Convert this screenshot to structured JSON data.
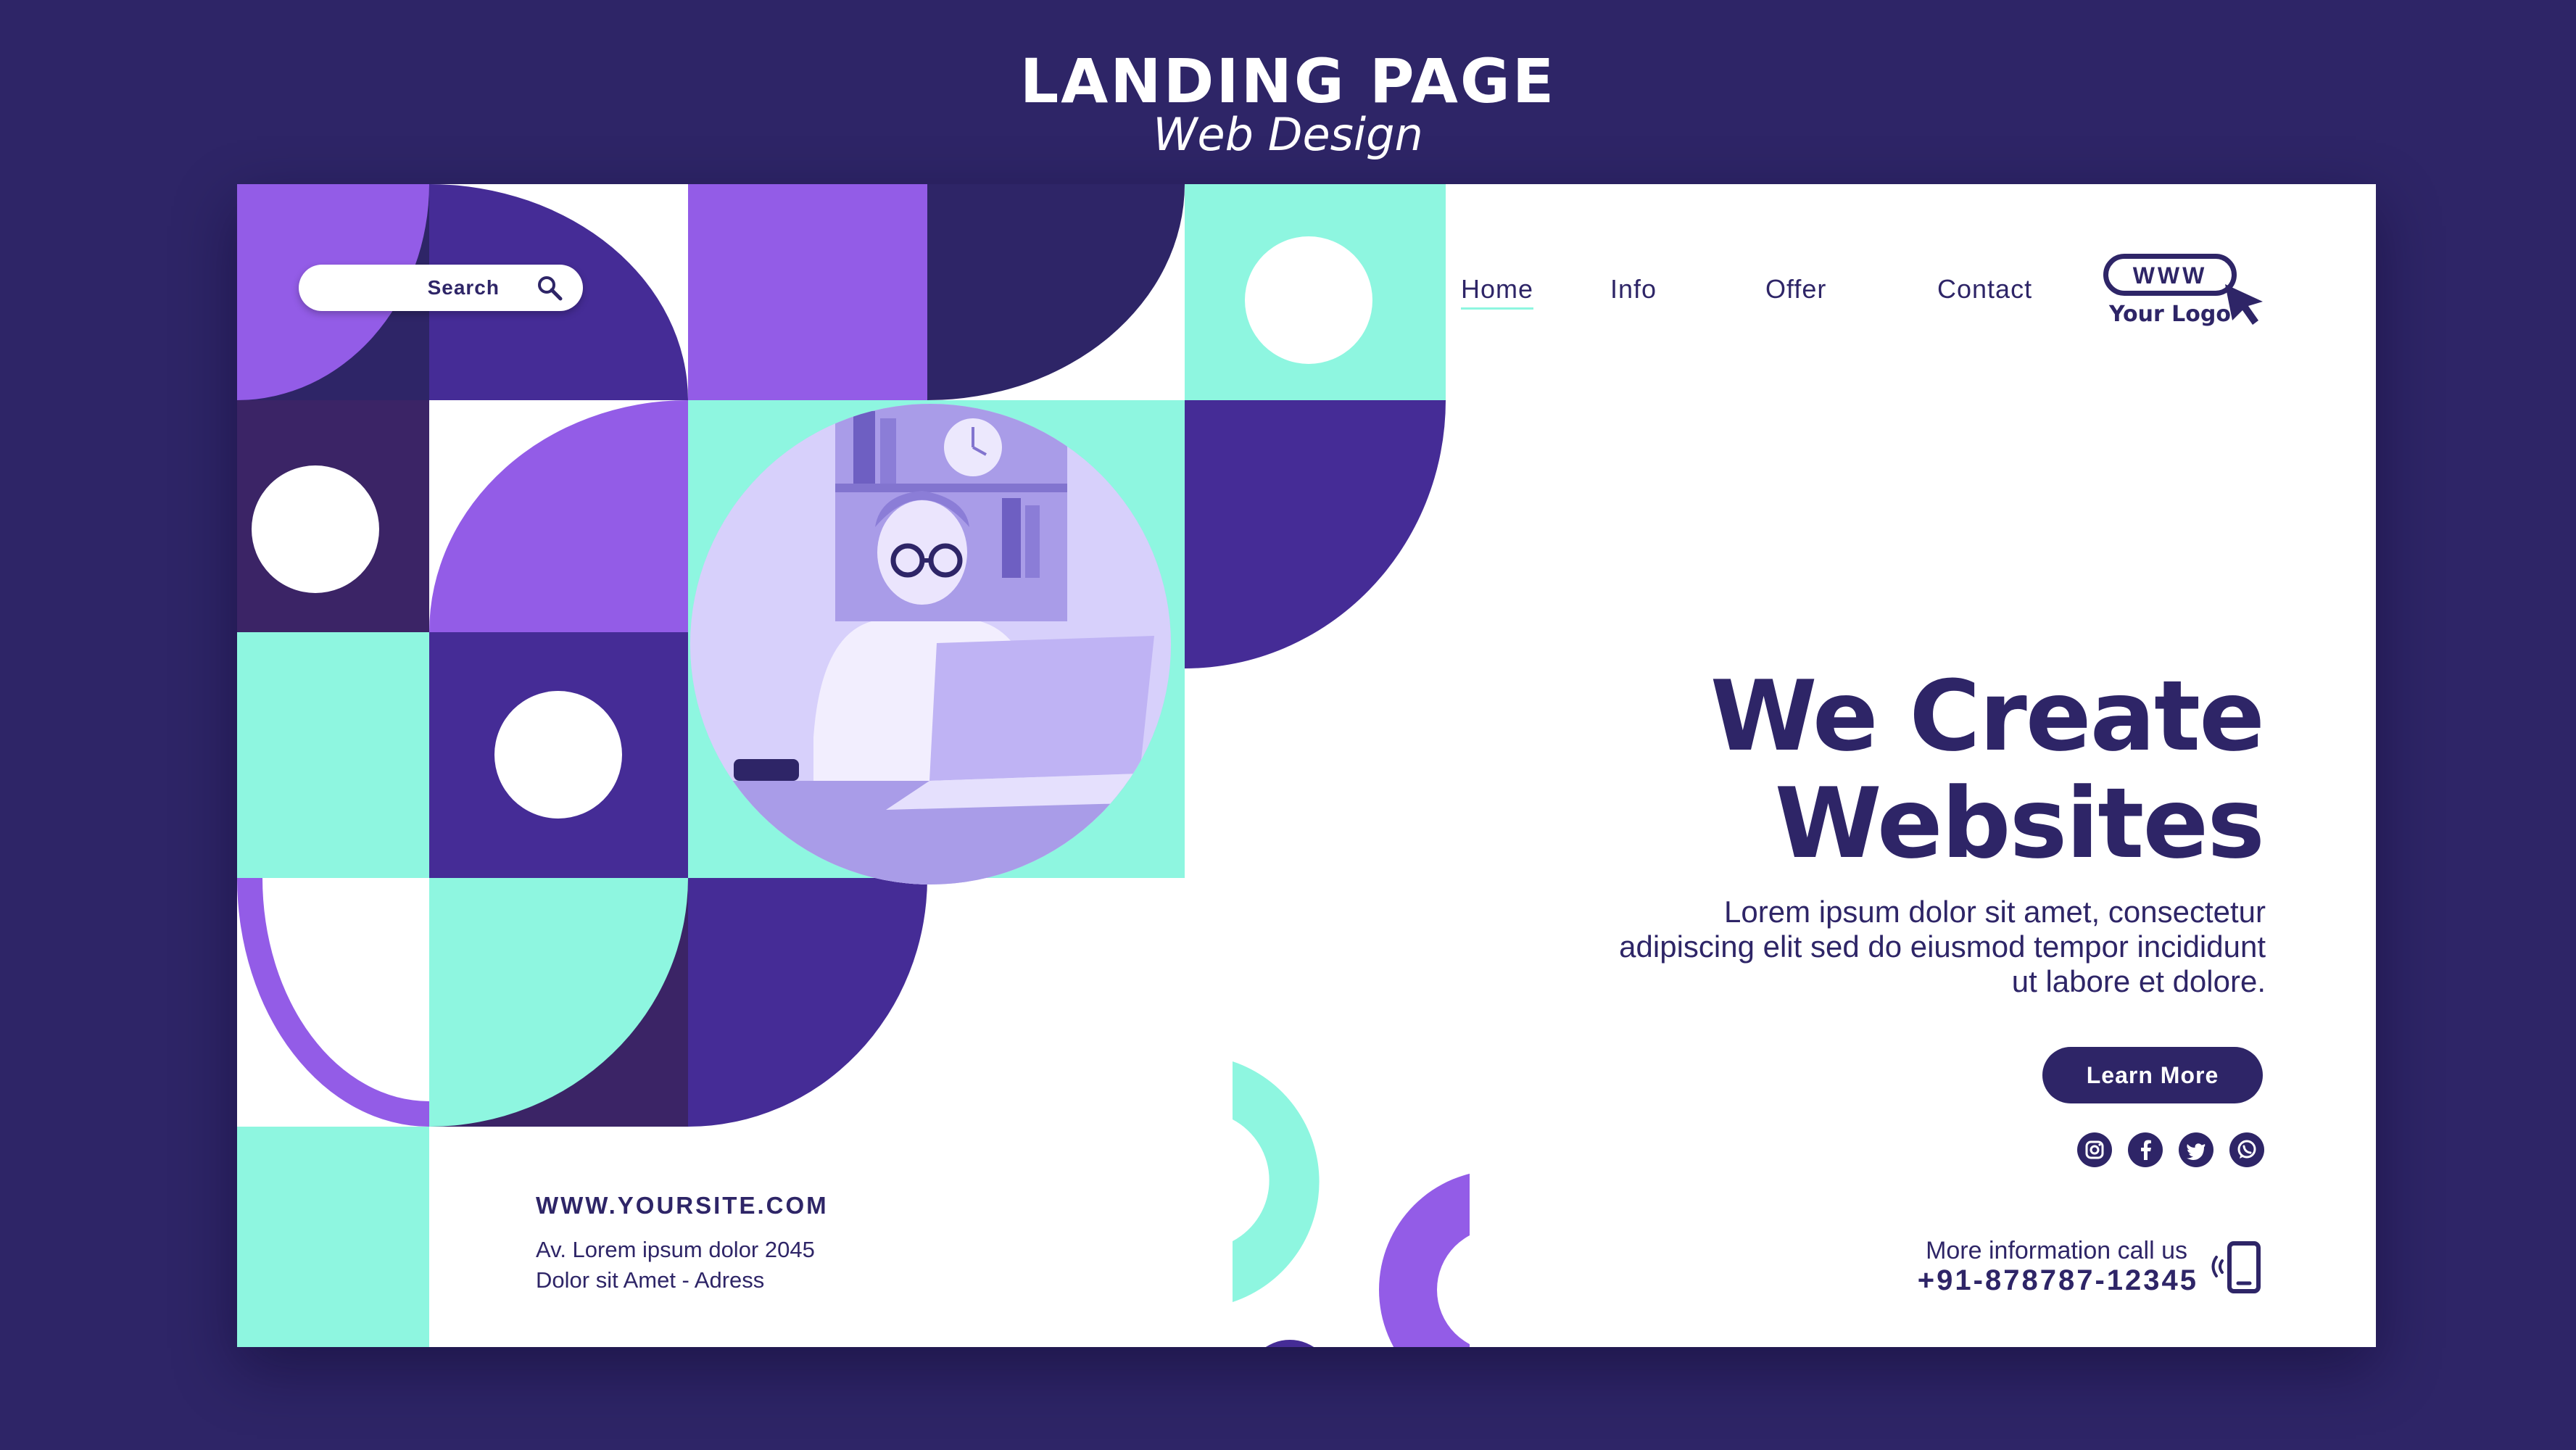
{
  "banner": {
    "title": "LANDING PAGE",
    "subtitle": "Web Design"
  },
  "search": {
    "label": "Search"
  },
  "nav": {
    "items": [
      {
        "label": "Home",
        "active": true
      },
      {
        "label": "Info"
      },
      {
        "label": "Offer"
      },
      {
        "label": "Contact"
      }
    ]
  },
  "logo": {
    "www": "WWW",
    "text": "Your Logo"
  },
  "hero": {
    "line1": "We Create",
    "line2": "Websites",
    "body": "Lorem ipsum dolor sit amet, consectetur adipiscing elit sed do eiusmod tempor incididunt ut labore et dolore.",
    "cta": "Learn More"
  },
  "social": [
    "instagram-icon",
    "facebook-icon",
    "twitter-icon",
    "whatsapp-icon"
  ],
  "footer": {
    "site": "WWW.YOURSITE.COM",
    "address1": "Av. Lorem ipsum dolor 2045",
    "address2": "Dolor sit Amet - Adress",
    "call_label": "More information call us",
    "phone": "+91-878787-12345"
  },
  "colors": {
    "navy": "#2e2567",
    "indigo": "#452c96",
    "purple": "#935ce7",
    "mint": "#8ef6e0",
    "deep": "#3b2466",
    "white": "#ffffff"
  }
}
